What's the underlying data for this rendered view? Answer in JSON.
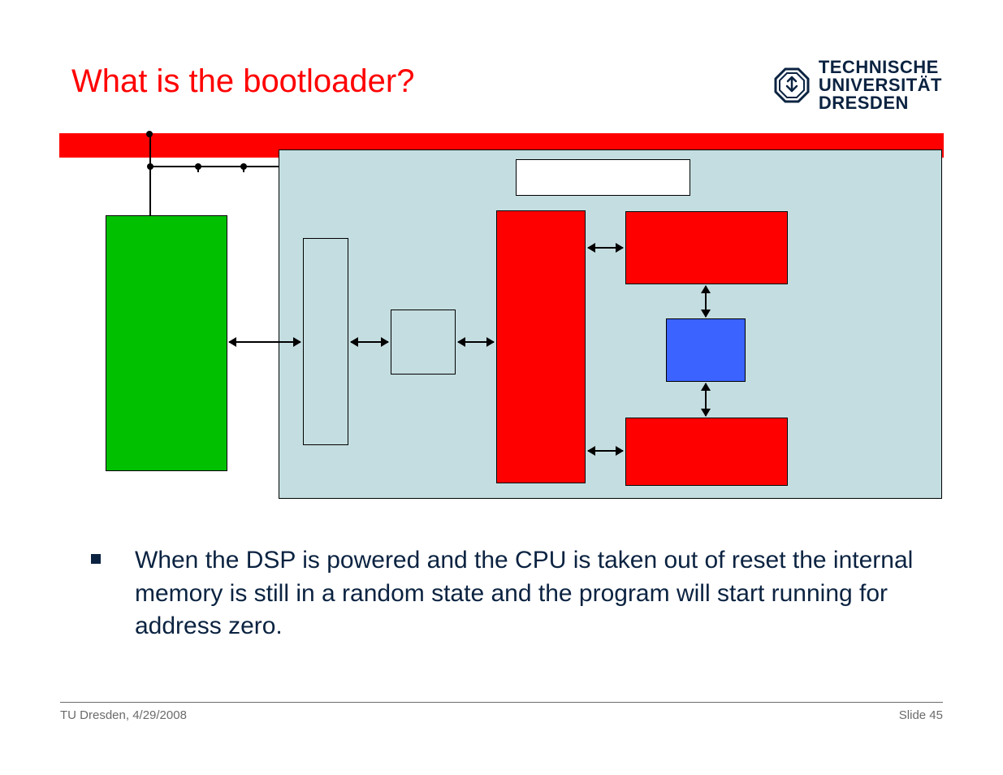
{
  "title": "What is the bootloader?",
  "logo": {
    "line1": "TECHNISCHE",
    "line2": "UNIVERSITÄT",
    "line3": "DRESDEN"
  },
  "bullet1": "When the DSP is powered and the CPU is taken out of reset the internal memory is still in a random state and the program will start running for address zero.",
  "footer_left": "TU Dresden, 4/29/2008",
  "footer_right": "Slide 45"
}
